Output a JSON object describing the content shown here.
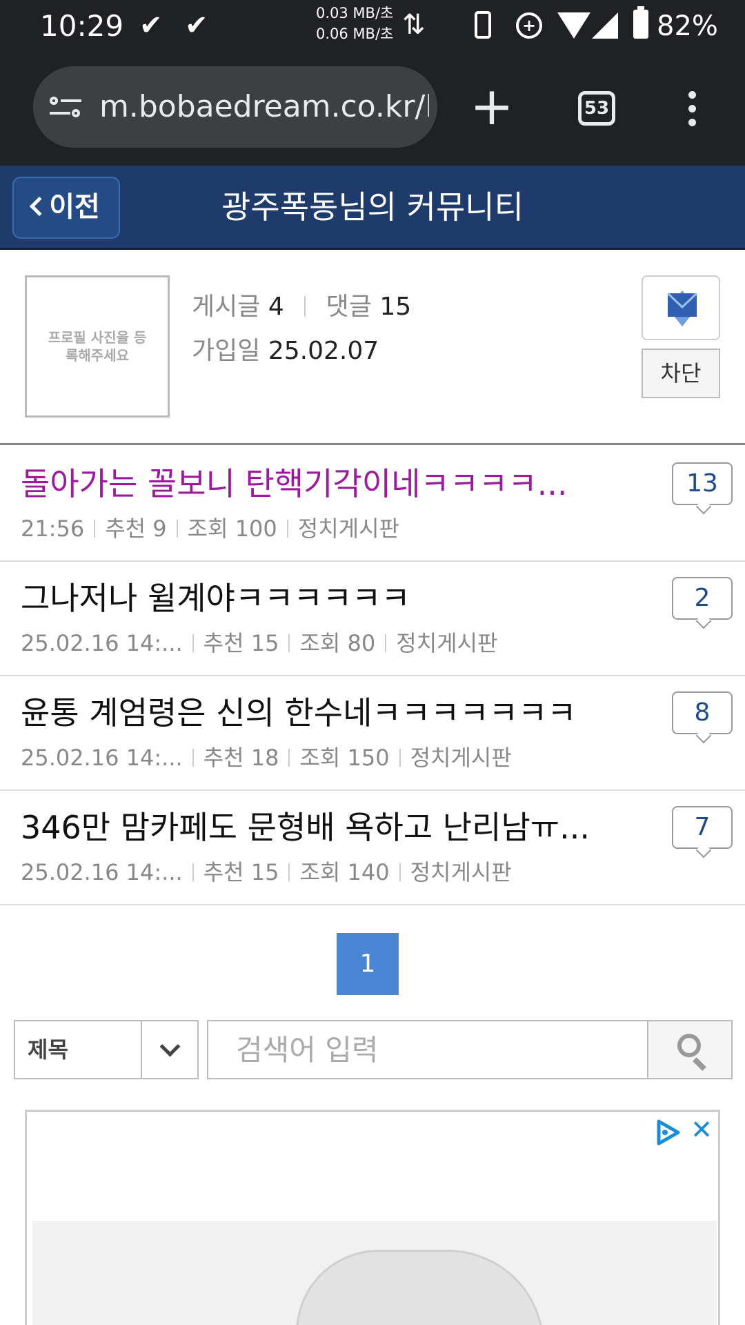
{
  "status_bar": {
    "time": "10:29",
    "check1": "✔",
    "check2": "✔",
    "upload_speed": "0.03 MB/초",
    "download_speed": "0.06 MB/초",
    "battery": "82%"
  },
  "browser": {
    "url": "m.bobaedream.co.kr/l",
    "new_tab_symbol": "+",
    "tab_count": "53"
  },
  "header": {
    "back_label": "이전",
    "title": "광주폭동님의 커뮤니티"
  },
  "profile": {
    "avatar_placeholder": "프로필 사진을 등록해주세요",
    "posts_label": "게시글",
    "posts_count": "4",
    "comments_label": "댓글",
    "comments_count": "15",
    "joined_label": "가입일",
    "joined_date": "25.02.07",
    "block_label": "차단"
  },
  "posts": [
    {
      "title": "돌아가는 꼴보니 탄핵기각이네ㅋㅋㅋㅋ...",
      "date": "21:56",
      "likes": "추천 9",
      "views": "조회 100",
      "board": "정치게시판",
      "comments": "13"
    },
    {
      "title": "그나저나 윌계야ㅋㅋㅋㅋㅋㅋ",
      "date": "25.02.16  14:...",
      "likes": "추천 15",
      "views": "조회 80",
      "board": "정치게시판",
      "comments": "2"
    },
    {
      "title": "윤통 계엄령은 신의 한수네ㅋㅋㅋㅋㅋㅋㅋ",
      "date": "25.02.16  14:...",
      "likes": "추천 18",
      "views": "조회 150",
      "board": "정치게시판",
      "comments": "8"
    },
    {
      "title": "346만 맘카페도 문형배 욕하고 난리남ㅠ...",
      "date": "25.02.16  14:...",
      "likes": "추천 15",
      "views": "조회 140",
      "board": "정치게시판",
      "comments": "7"
    }
  ],
  "pagination": {
    "current": "1"
  },
  "search": {
    "field_selected": "제목",
    "placeholder": "검색어 입력"
  },
  "ad": {
    "close_symbol": "✕"
  },
  "colors": {
    "header_bg": "#1e3b6c",
    "visited_title": "#9c1a9c",
    "page_active": "#4a86d4",
    "comment_count": "#1e4a8c"
  }
}
